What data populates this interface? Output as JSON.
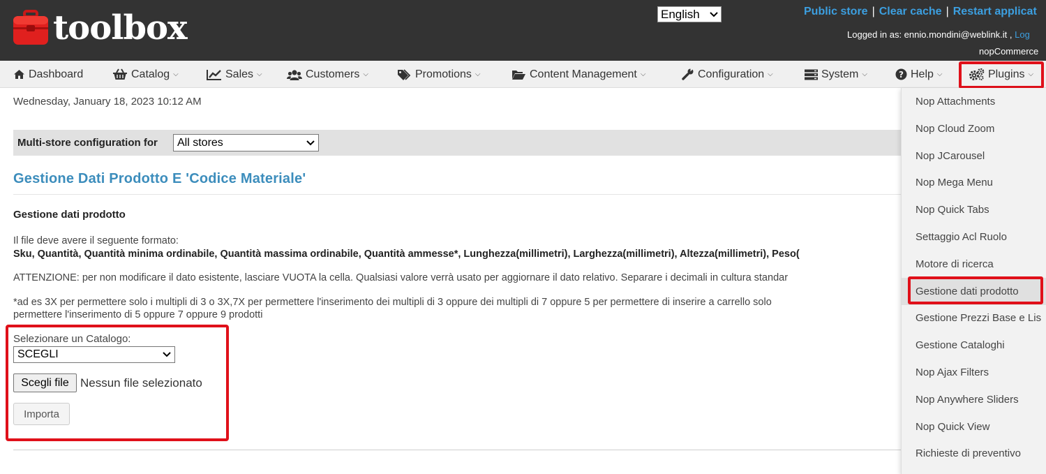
{
  "header": {
    "logo_text": "toolbox",
    "language": "English",
    "links": [
      "Public store",
      "Clear cache",
      "Restart applicat"
    ],
    "logged_in_prefix": "Logged in as: ennio.mondini@weblink.it ,",
    "logout_label": "Log",
    "version_text": "nopCommerce"
  },
  "nav": {
    "items": [
      {
        "label": "Dashboard",
        "icon": "home-icon"
      },
      {
        "label": "Catalog",
        "icon": "basket-icon"
      },
      {
        "label": "Sales",
        "icon": "line-chart-icon"
      },
      {
        "label": "Customers",
        "icon": "users-icon"
      },
      {
        "label": "Promotions",
        "icon": "tags-icon"
      },
      {
        "label": "Content Management",
        "icon": "folder-open-icon"
      },
      {
        "label": "Configuration",
        "icon": "wrench-icon"
      },
      {
        "label": "System",
        "icon": "server-icon"
      },
      {
        "label": "Help",
        "icon": "question-circle-icon"
      },
      {
        "label": "Plugins",
        "icon": "cogs-icon"
      }
    ]
  },
  "main": {
    "date": "Wednesday, January 18, 2023 10:12 AM",
    "store_label": "Multi-store configuration for",
    "store_value": "All stores",
    "title": "Gestione Dati Prodotto E 'Codice Materiale'",
    "section_heading": "Gestione dati prodotto",
    "format_intro": "Il file deve avere il seguente formato:",
    "format_columns": "Sku, Quantità, Quantità minima ordinabile, Quantità massima ordinabile, Quantità ammesse*, Lunghezza(millimetri), Larghezza(millimetri), Altezza(millimetri), Peso(",
    "warning": "ATTENZIONE: per non modificare il dato esistente, lasciare VUOTA la cella. Qualsiasi valore verrà usato per aggiornare il dato relativo.  Separare i decimali in cultura standar",
    "note_line1": "*ad es 3X per permettere solo i multipli di 3 o 3X,7X per permettere l'inserimento dei multipli di 3 oppure dei multipli di 7 oppure 5 per permettere di inserire a carrello solo",
    "note_line2": "permettere l'inserimento di 5 oppure 7 oppure 9 prodotti",
    "catalog_label": "Selezionare un Catalogo:",
    "catalog_value": "SCEGLI",
    "file_button": "Scegli file",
    "file_none": "Nessun file selezionato",
    "import_button": "Importa"
  },
  "plugins_menu": {
    "items": [
      "Nop Attachments",
      "Nop Cloud Zoom",
      "Nop JCarousel",
      "Nop Mega Menu",
      "Nop Quick Tabs",
      "Settaggio Acl Ruolo",
      "Motore di ricerca",
      "Gestione dati prodotto",
      "Gestione Prezzi Base e Lis",
      "Gestione Cataloghi",
      "Nop Ajax Filters",
      "Nop Anywhere Sliders",
      "Nop Quick View",
      "Richieste di preventivo"
    ],
    "active_index": 7
  },
  "colors": {
    "header_bg": "#333333",
    "link": "#3c9fe0",
    "title": "#3c8dbc",
    "highlight": "#e0101a",
    "nav_bg": "#f0f0f0"
  }
}
